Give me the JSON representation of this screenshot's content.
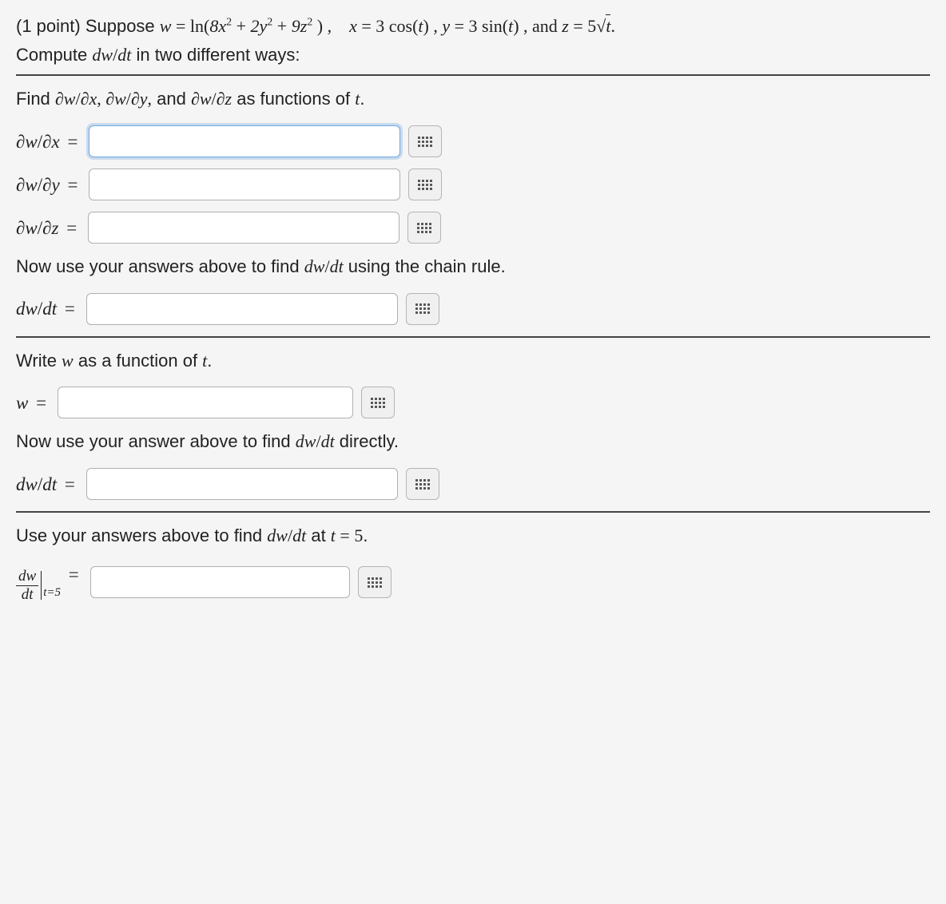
{
  "problem": {
    "points_prefix": "(1 point) Suppose ",
    "math_stmt_html": "w = ln(8x² + 2y² + 9z²) ,   x = 3 cos(t) , y = 3 sin(t) , and z = 5√t.",
    "compute_line": "Compute dw/dt in two different ways:"
  },
  "section1": {
    "instr": "Find ∂w/∂x, ∂w/∂y, and ∂w/∂z as functions of t.",
    "rows": {
      "dwdx_label": "∂w/∂x =",
      "dwdy_label": "∂w/∂y =",
      "dwdz_label": "∂w/∂z ="
    }
  },
  "section2": {
    "instr": "Now use your answers above to find dw/dt using the chain rule.",
    "dwdt_label": "dw/dt ="
  },
  "section3": {
    "instr": "Write w as a function of t.",
    "w_label": "w ="
  },
  "section4": {
    "instr": "Now use your answer above to find dw/dt directly.",
    "dwdt_label": "dw/dt ="
  },
  "section5": {
    "instr": "Use your answers above to find dw/dt at t = 5.",
    "eval_num": "dw",
    "eval_den": "dt",
    "eval_sub": "t=5",
    "eq": " ="
  },
  "values": {
    "dwdx": "",
    "dwdy": "",
    "dwdz": "",
    "dwdt_chain": "",
    "w_of_t": "",
    "dwdt_direct": "",
    "dwdt_at5": ""
  }
}
